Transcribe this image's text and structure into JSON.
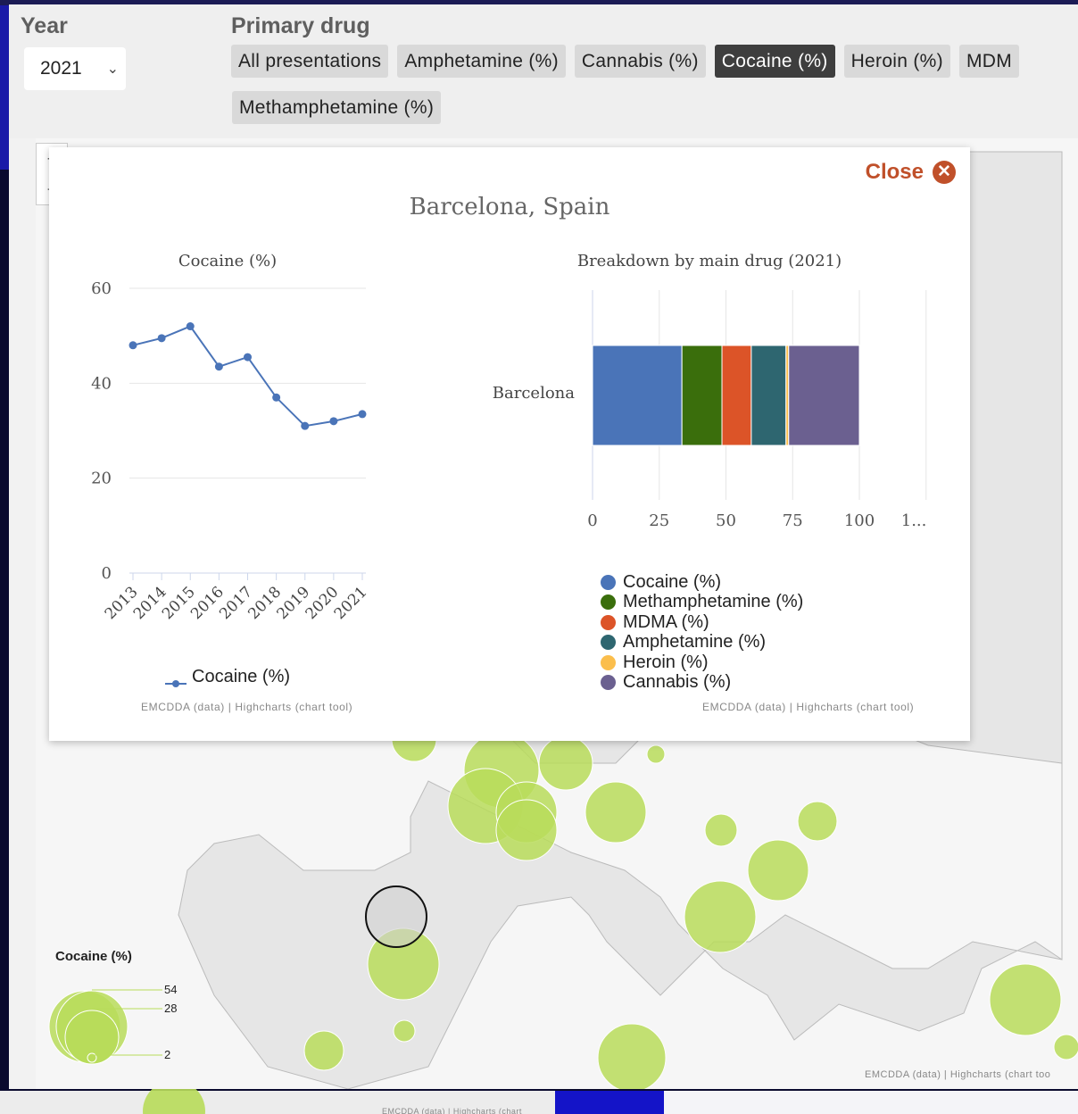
{
  "controls": {
    "year_label": "Year",
    "year_value": "2021",
    "drug_label": "Primary drug",
    "chips": [
      {
        "label": "All presentations",
        "active": false
      },
      {
        "label": "Amphetamine (%)",
        "active": false
      },
      {
        "label": "Cannabis (%)",
        "active": false
      },
      {
        "label": "Cocaine (%)",
        "active": true
      },
      {
        "label": "Heroin (%)",
        "active": false
      },
      {
        "label": "MDM",
        "active": false
      }
    ],
    "chip_row2": "Methamphetamine (%)"
  },
  "popup": {
    "close_label": "Close",
    "title": "Barcelona, Spain",
    "line_legend": "Cocaine (%)",
    "credit_left": "EMCDDA (data) | Highcharts (chart tool)",
    "credit_right": "EMCDDA (data) | Highcharts (chart tool)"
  },
  "map": {
    "legend_title": "Cocaine (%)",
    "legend_values": [
      "54",
      "28",
      "2"
    ],
    "credit": "EMCDDA (data) | Highcharts (chart too",
    "bottom_credit": "EMCDDA (data) | Highcharts (chart"
  },
  "colors": {
    "cocaine": "#4a74b8",
    "methamphetamine": "#3a6e0c",
    "mdma": "#dc5428",
    "amphetamine": "#2e6670",
    "heroin": "#fbbe4c",
    "cannabis": "#6b6090",
    "bubble": "#b8dc5a",
    "close": "#c0502a"
  },
  "chart_data": [
    {
      "type": "line",
      "title": "Cocaine (%)",
      "x": [
        "2013",
        "2014",
        "2015",
        "2016",
        "2017",
        "2018",
        "2019",
        "2020",
        "2021"
      ],
      "series": [
        {
          "name": "Cocaine (%)",
          "values": [
            48,
            49.5,
            52,
            43.5,
            45.5,
            37,
            31,
            32,
            33.5
          ]
        }
      ],
      "yticks": [
        "60",
        "40",
        "20",
        "0"
      ],
      "ylim": [
        0,
        60
      ]
    },
    {
      "type": "bar",
      "title": "Breakdown by main drug (2021)",
      "categories": [
        "Barcelona"
      ],
      "stacked": true,
      "series": [
        {
          "name": "Cocaine (%)",
          "values": [
            33.5
          ]
        },
        {
          "name": "Methamphetamine (%)",
          "values": [
            15
          ]
        },
        {
          "name": "MDMA (%)",
          "values": [
            11
          ]
        },
        {
          "name": "Amphetamine (%)",
          "values": [
            13
          ]
        },
        {
          "name": "Heroin (%)",
          "values": [
            1
          ]
        },
        {
          "name": "Cannabis (%)",
          "values": [
            26.5
          ]
        }
      ],
      "xticks": [
        "0",
        "25",
        "50",
        "75",
        "100",
        "1..."
      ],
      "xlim": [
        0,
        125
      ]
    }
  ]
}
